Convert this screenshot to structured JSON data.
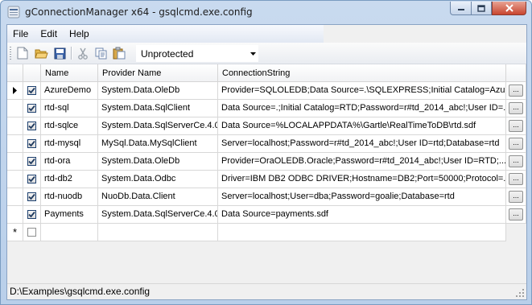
{
  "window": {
    "title": "gConnectionManager x64 - gsqlcmd.exe.config",
    "app_icon": "app-icon"
  },
  "menu": {
    "items": [
      {
        "label": "File"
      },
      {
        "label": "Edit"
      },
      {
        "label": "Help"
      }
    ]
  },
  "toolbar": {
    "buttons": [
      "new-icon",
      "open-icon",
      "save-icon",
      "cut-icon",
      "copy-icon",
      "paste-icon"
    ],
    "protection_value": "Unprotected"
  },
  "grid": {
    "columns": [
      "",
      "",
      "Name",
      "Provider Name",
      "ConnectionString",
      ""
    ],
    "rows": [
      {
        "current": true,
        "checked": true,
        "name": "AzureDemo",
        "provider": "System.Data.OleDb",
        "connection": "Provider=SQLOLEDB;Data Source=.\\SQLEXPRESS;Initial Catalog=Azu..."
      },
      {
        "current": false,
        "checked": true,
        "name": "rtd-sql",
        "provider": "System.Data.SqlClient",
        "connection": "Data Source=.;Initial Catalog=RTD;Password=r#td_2014_abc!;User ID=..."
      },
      {
        "current": false,
        "checked": true,
        "name": "rtd-sqlce",
        "provider": "System.Data.SqlServerCe.4.0",
        "connection": "Data Source=%LOCALAPPDATA%\\Gartle\\RealTimeToDB\\rtd.sdf"
      },
      {
        "current": false,
        "checked": true,
        "name": "rtd-mysql",
        "provider": "MySql.Data.MySqlClient",
        "connection": "Server=localhost;Password=r#td_2014_abc!;User ID=rtd;Database=rtd"
      },
      {
        "current": false,
        "checked": true,
        "name": "rtd-ora",
        "provider": "System.Data.OleDb",
        "connection": "Provider=OraOLEDB.Oracle;Password=r#td_2014_abc!;User ID=RTD;..."
      },
      {
        "current": false,
        "checked": true,
        "name": "rtd-db2",
        "provider": "System.Data.Odbc",
        "connection": "Driver=IBM DB2 ODBC DRIVER;Hostname=DB2;Port=50000;Protocol=..."
      },
      {
        "current": false,
        "checked": true,
        "name": "rtd-nuodb",
        "provider": "NuoDb.Data.Client",
        "connection": "Server=localhost;User=dba;Password=goalie;Database=rtd"
      },
      {
        "current": false,
        "checked": true,
        "name": "Payments",
        "provider": "System.Data.SqlServerCe.4.0",
        "connection": "Data Source=payments.sdf"
      }
    ],
    "new_row_marker": "*",
    "ellipsis_label": "..."
  },
  "status": {
    "path": "D:\\Examples\\gsqlcmd.exe.config"
  }
}
